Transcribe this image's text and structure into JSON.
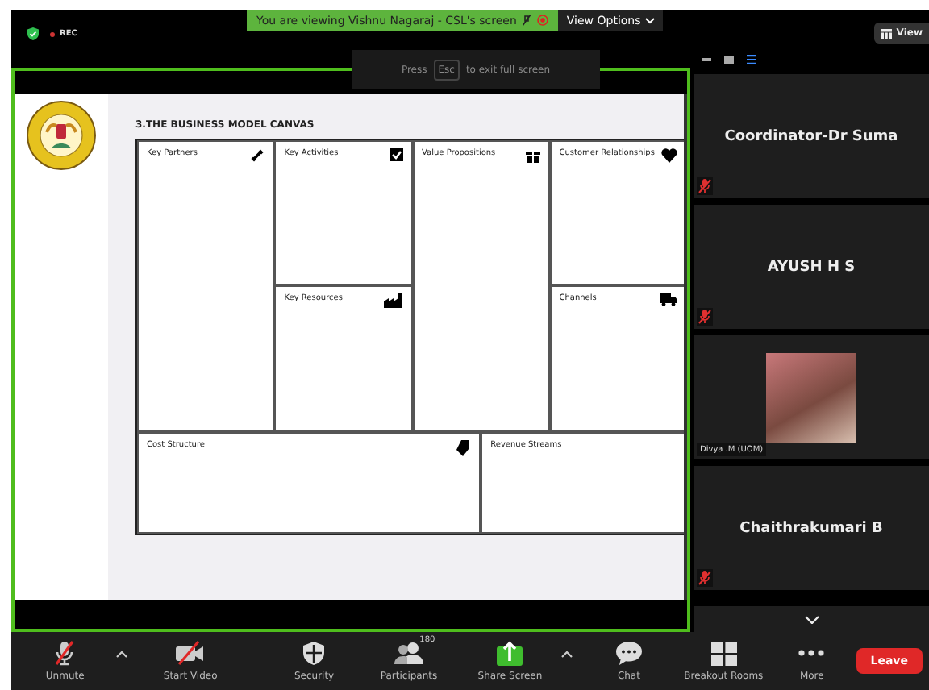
{
  "top_bar": {
    "recording": "REC",
    "banner": "You are viewing Vishnu Nagaraj - CSL's screen",
    "view_options": "View Options",
    "view_button": "View"
  },
  "fullscreen_hint": {
    "prefix": "Press",
    "key": "Esc",
    "suffix": "to exit full screen"
  },
  "slide": {
    "title": "3.THE BUSINESS MODEL CANVAS",
    "blocks": [
      {
        "label": "Key Partners"
      },
      {
        "label": "Key Activities"
      },
      {
        "label": "Key Resources"
      },
      {
        "label": "Value Propositions"
      },
      {
        "label": "Customer Relationships"
      },
      {
        "label": "Channels"
      },
      {
        "label": "Cost Structure"
      },
      {
        "label": "Revenue Streams"
      }
    ]
  },
  "participants": [
    {
      "name": "Coordinator-Dr Suma",
      "kind": "name",
      "muted": true
    },
    {
      "name": "AYUSH H S",
      "kind": "name",
      "muted": true
    },
    {
      "name": "Divya .M (UOM)",
      "kind": "video",
      "muted": false
    },
    {
      "name": "Chaithrakumari B",
      "kind": "name",
      "muted": true
    }
  ],
  "toolbar": [
    {
      "label": "Unmute",
      "caret": true
    },
    {
      "label": "Start Video",
      "caret": false
    },
    {
      "label": "Security",
      "caret": false
    },
    {
      "label": "Participants",
      "badge": "180",
      "caret": false
    },
    {
      "label": "Share Screen",
      "caret": true
    },
    {
      "label": "Chat",
      "caret": false
    },
    {
      "label": "Breakout Rooms",
      "caret": false
    },
    {
      "label": "More",
      "caret": false
    }
  ],
  "leave": "Leave"
}
